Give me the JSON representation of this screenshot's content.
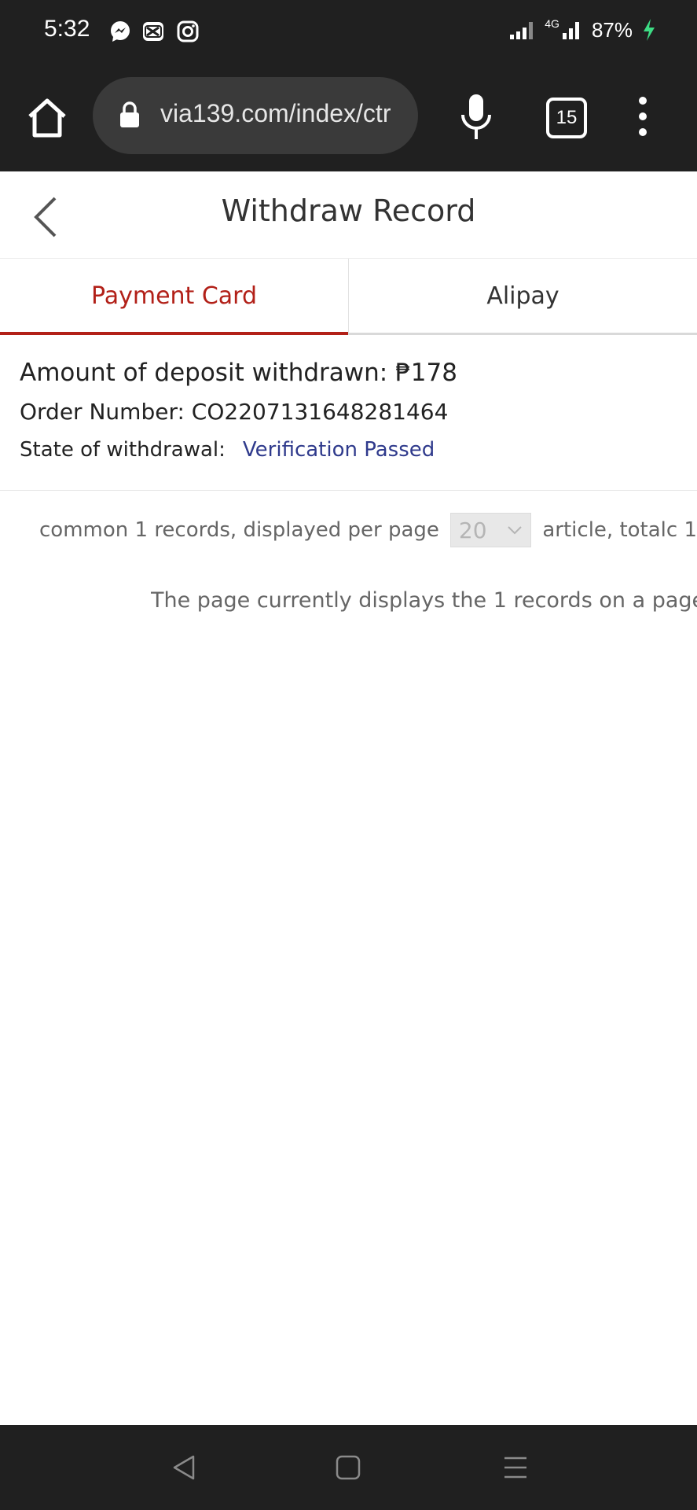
{
  "status_bar": {
    "time": "5:32",
    "network": "4G",
    "battery": "87%",
    "icons": [
      "messenger-icon",
      "capcut-icon",
      "instagram-icon",
      "signal-icon",
      "lte-signal-icon",
      "charging-icon"
    ]
  },
  "browser": {
    "url": "via139.com/index/ctr",
    "tab_count": "15",
    "icons": [
      "home-icon",
      "lock-icon",
      "mic-icon",
      "tabs-icon",
      "more-vertical-icon"
    ]
  },
  "header": {
    "title": "Withdraw Record",
    "back_icon": "chevron-left-icon"
  },
  "tabs": [
    {
      "label": "Payment Card",
      "active": true
    },
    {
      "label": "Alipay",
      "active": false
    }
  ],
  "record": {
    "amount_label": "Amount of deposit withdrawn:",
    "amount_value": "₱178",
    "order_label": "Order Number:",
    "order_value": "CO2207131648281464",
    "state_label": "State of withdrawal:",
    "state_value": "Verification Passed"
  },
  "pagination": {
    "prefix": "common 1 records, displayed per page",
    "page_size": "20",
    "suffix": "article, totalc 1",
    "summary": "The page currently displays the 1 records on a page"
  },
  "nav_bar": {
    "icons": [
      "back-triangle-icon",
      "home-square-icon",
      "recents-menu-icon"
    ]
  },
  "colors": {
    "system_bar": "#202020",
    "accent_red": "#b22018",
    "status_blue": "#2f3a8c"
  }
}
